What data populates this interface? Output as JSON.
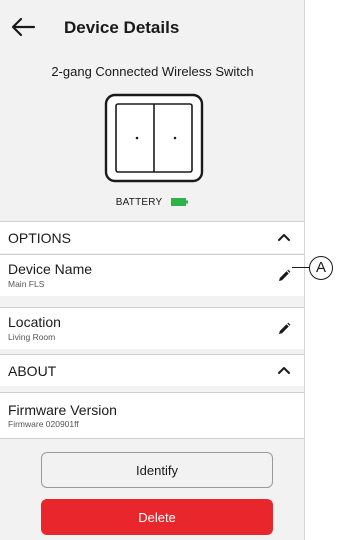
{
  "header": {
    "title": "Device Details",
    "back_icon": "arrow-left-icon"
  },
  "device": {
    "model": "2-gang Connected Wireless Switch",
    "battery_label": "BATTERY",
    "battery_color": "#2db34a"
  },
  "options_section": {
    "label": "OPTIONS",
    "expanded": true,
    "items": [
      {
        "title": "Device Name",
        "subtitle": "Main FLS",
        "icon": "pencil-icon"
      },
      {
        "title": "Location",
        "subtitle": "Living Room",
        "icon": "pencil-icon"
      }
    ]
  },
  "about_section": {
    "label": "ABOUT",
    "expanded": true,
    "items": [
      {
        "title": "Firmware Version",
        "subtitle": "Firmware 020901ff"
      }
    ]
  },
  "actions": {
    "identify_label": "Identify",
    "delete_label": "Delete",
    "delete_color": "#e8262b"
  },
  "callout": {
    "label": "A"
  }
}
